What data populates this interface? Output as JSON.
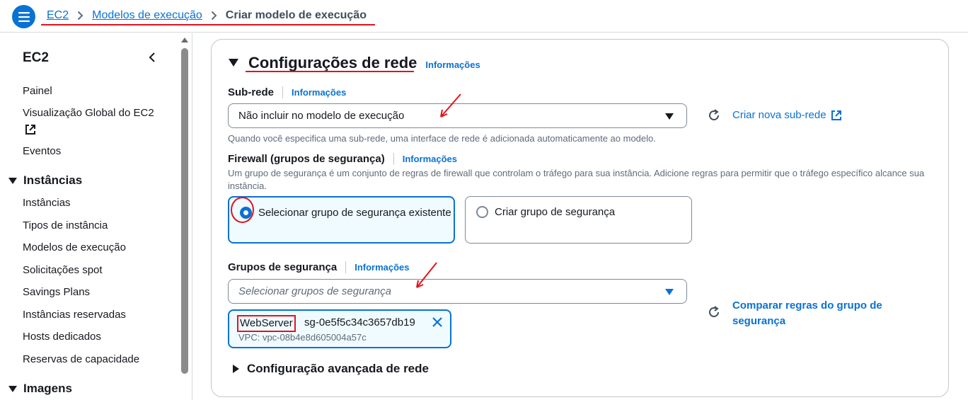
{
  "breadcrumb": {
    "items": [
      "EC2",
      "Modelos de execução"
    ],
    "current": "Criar modelo de execução"
  },
  "sidebar": {
    "title": "EC2",
    "items": [
      "Painel",
      "Visualização Global do EC2",
      "Eventos"
    ],
    "sections": [
      {
        "label": "Instâncias",
        "items": [
          "Instâncias",
          "Tipos de instância",
          "Modelos de execução",
          "Solicitações spot",
          "Savings Plans",
          "Instâncias reservadas",
          "Hosts dedicados",
          "Reservas de capacidade"
        ]
      },
      {
        "label": "Imagens"
      }
    ]
  },
  "network": {
    "title": "Configurações de rede",
    "info": "Informações",
    "subnet": {
      "label": "Sub-rede",
      "info": "Informações",
      "value": "Não incluir no modelo de execução",
      "description": "Quando você especifica uma sub-rede, uma interface de rede é adicionada automaticamente ao modelo.",
      "create_link": "Criar nova sub-rede"
    },
    "firewall": {
      "label": "Firewall (grupos de segurança)",
      "info": "Informações",
      "description": "Um grupo de segurança é um conjunto de regras de firewall que controlam o tráfego para sua instância. Adicione regras para permitir que o tráfego específico alcance sua instância.",
      "option_existing": "Selecionar grupo de segurança existente",
      "option_create": "Criar grupo de segurança",
      "selected": "existing"
    },
    "security_groups": {
      "label": "Grupos de segurança",
      "info": "Informações",
      "placeholder": "Selecionar grupos de segurança",
      "compare_link": "Comparar regras do grupo de segurança",
      "token": {
        "name": "WebServer",
        "id": "sg-0e5f5c34c3657db19",
        "vpc": "VPC: vpc-08b4e8d605004a57c"
      }
    },
    "advanced": "Configuração avançada de rede"
  },
  "colors": {
    "accent": "#0972d3",
    "annotation": "#e0141e"
  }
}
